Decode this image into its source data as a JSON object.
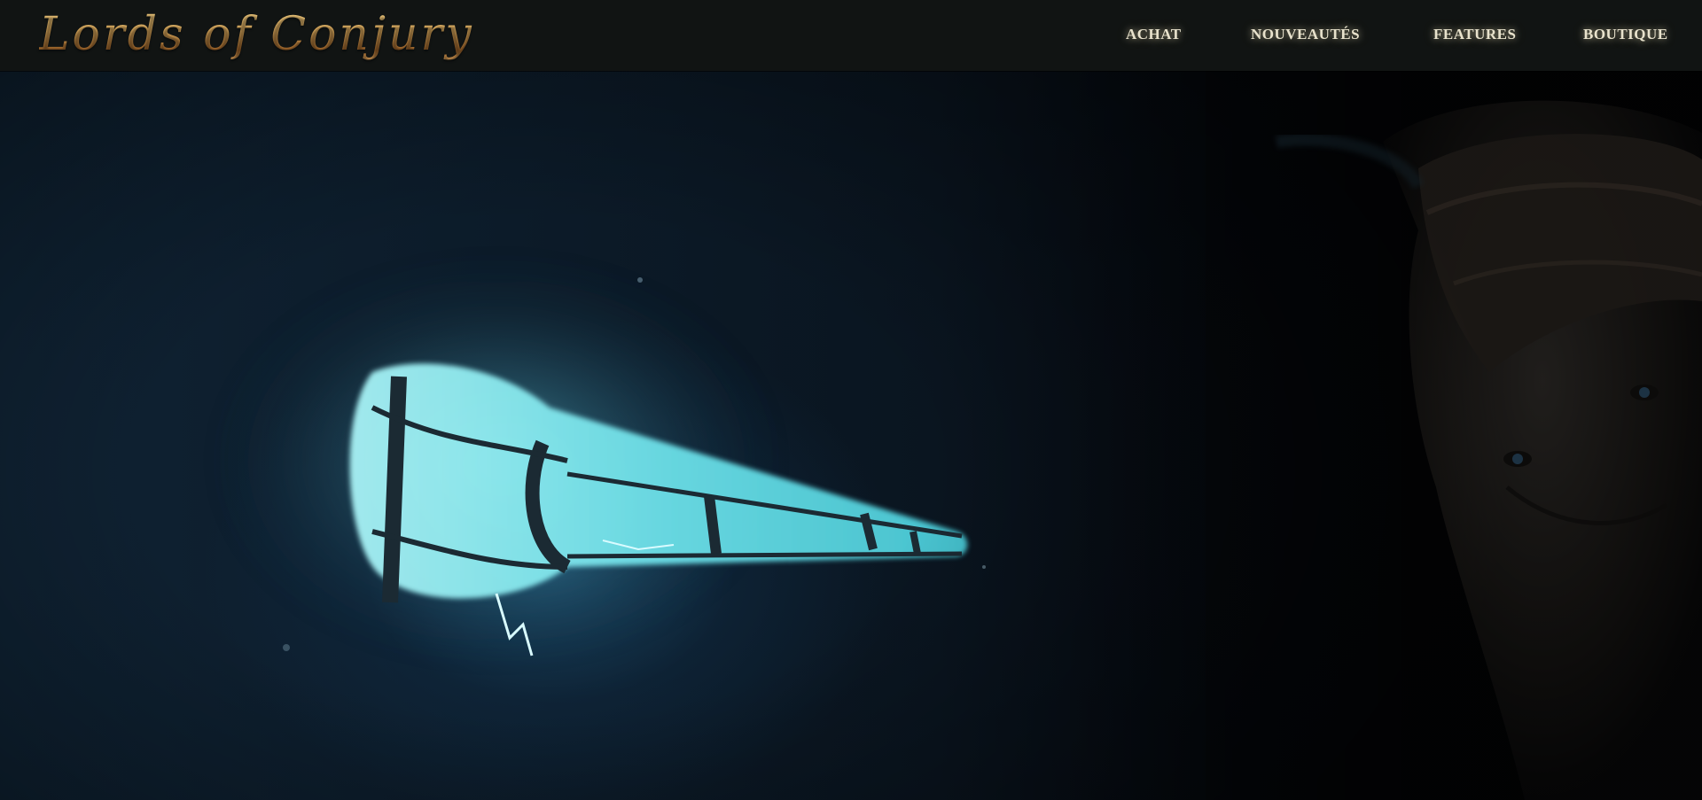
{
  "site": {
    "logo_text": "Lords of Conjury"
  },
  "nav": {
    "items": [
      {
        "label": "ACHAT"
      },
      {
        "label": "NOUVEAUTÉS"
      },
      {
        "label": "FEATURES"
      },
      {
        "label": "BOUTIQUE"
      }
    ]
  },
  "hero": {
    "scene": "hero-image"
  },
  "colors": {
    "topbar_bg": "#111413",
    "logo_gold": "#d9a75a",
    "nav_text": "#e8e2cc",
    "glow_cyan": "#7fe9f0",
    "backdrop_blue": "#0c1b29"
  }
}
